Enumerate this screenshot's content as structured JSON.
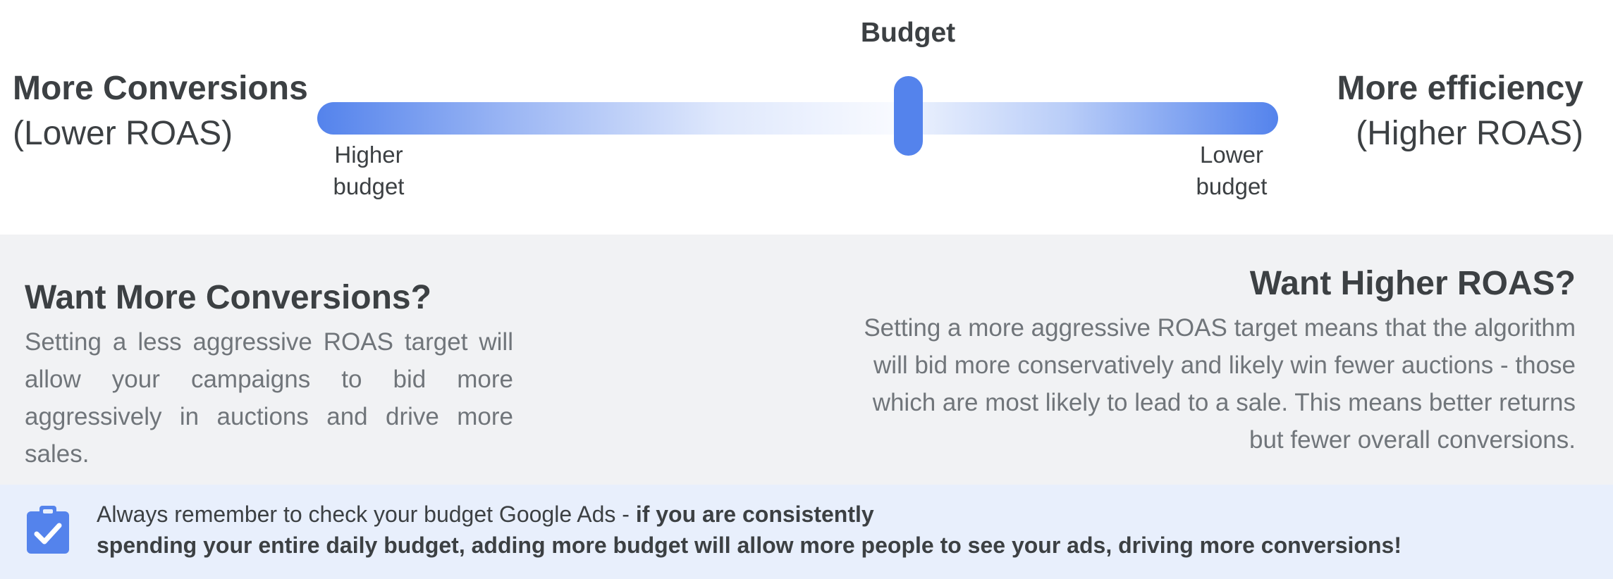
{
  "header": {
    "budget_label": "Budget",
    "left": {
      "title": "More Conversions",
      "subtitle": "(Lower ROAS)"
    },
    "right": {
      "title": "More efficiency",
      "subtitle": "(Higher ROAS)"
    },
    "slider": {
      "left_end": [
        "Higher",
        "budget"
      ],
      "right_end": [
        "Lower",
        "budget"
      ],
      "knob_level": 0.5,
      "color": "#5483ec"
    }
  },
  "cards": {
    "left": {
      "heading": "Want More Conversions?",
      "body": "Setting a less aggressive ROAS target will allow your campaigns to bid more aggressively in auctions and drive more sales."
    },
    "right": {
      "heading": "Want Higher ROAS?",
      "body": "Setting a more aggressive ROAS target means that the algorithm will bid more conservatively and likely win fewer auctions - those which are most likely to lead to a sale.  This means better returns but fewer overall conversions."
    }
  },
  "note": {
    "icon": "clipboard-check-icon",
    "normal_text": "Always remember to check your budget Google Ads - ",
    "bold_text_line1": "if you are consistently",
    "bold_text_line2": "spending your entire daily budget, adding more budget will allow more people to see your ads, driving more conversions!"
  },
  "colors": {
    "accent": "#5483ec",
    "panel_background": "#f1f2f4",
    "note_background": "#e8effc",
    "heading_text": "#3c4043",
    "body_text": "#70757a"
  }
}
